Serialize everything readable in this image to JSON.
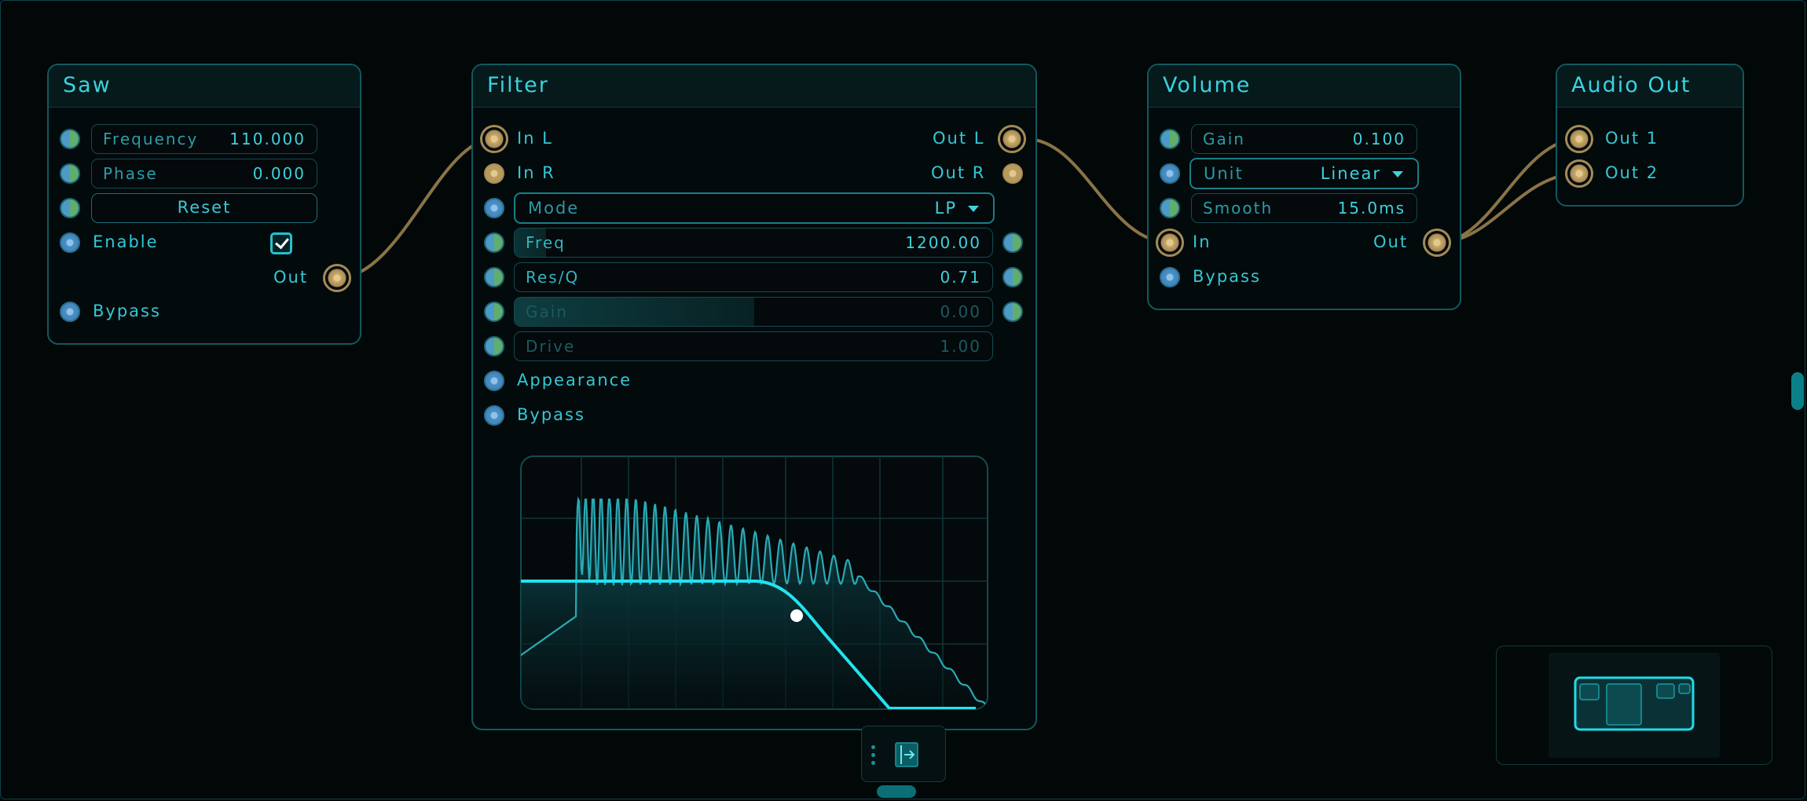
{
  "colors": {
    "accent": "#2ec7d2",
    "wire": "#8a7446",
    "port_audio": "#c9a865",
    "port_control": "#4a8fc4",
    "background": "#020708"
  },
  "saw": {
    "title": "Saw",
    "frequency": {
      "label": "Frequency",
      "value": "110.000"
    },
    "phase": {
      "label": "Phase",
      "value": "0.000"
    },
    "reset_label": "Reset",
    "enable_label": "Enable",
    "enable_checked": true,
    "out_label": "Out",
    "bypass_label": "Bypass"
  },
  "filter": {
    "title": "Filter",
    "in_l": "In L",
    "in_r": "In R",
    "out_l": "Out L",
    "out_r": "Out R",
    "mode": {
      "label": "Mode",
      "value": "LP"
    },
    "freq": {
      "label": "Freq",
      "value": "1200.00"
    },
    "resq": {
      "label": "Res/Q",
      "value": "0.71"
    },
    "gain": {
      "label": "Gain",
      "value": "0.00"
    },
    "drive": {
      "label": "Drive",
      "value": "1.00"
    },
    "appearance_label": "Appearance",
    "bypass_label": "Bypass",
    "graph": {
      "response_curve": "lowpass",
      "spectrum": "harmonic"
    }
  },
  "volume": {
    "title": "Volume",
    "gain": {
      "label": "Gain",
      "value": "0.100"
    },
    "unit": {
      "label": "Unit",
      "value": "Linear"
    },
    "smooth": {
      "label": "Smooth",
      "value": "15.0ms"
    },
    "in_label": "In",
    "out_label": "Out",
    "bypass_label": "Bypass"
  },
  "audio_out": {
    "title": "Audio Out",
    "out1": "Out 1",
    "out2": "Out 2"
  },
  "toolbar": {
    "menu_icon": "vertical-dots-icon",
    "exit_icon": "exit-icon"
  }
}
